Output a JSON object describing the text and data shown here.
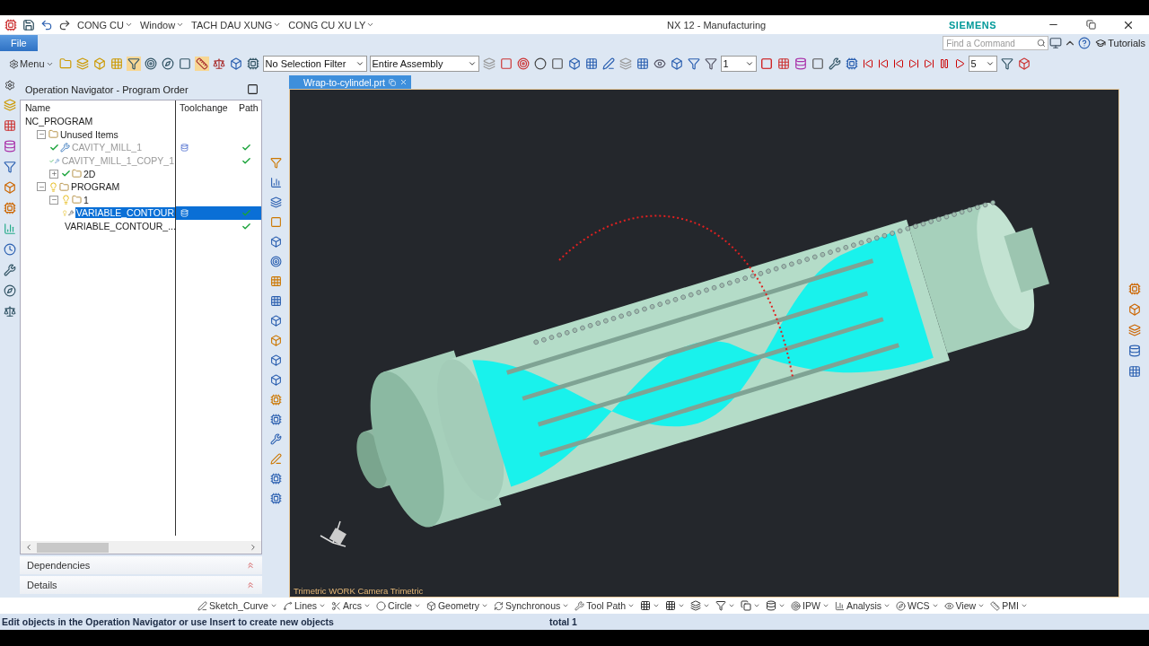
{
  "quick_access": {
    "menus": [
      {
        "label": "CONG CU"
      },
      {
        "label": "Window"
      },
      {
        "label": "TACH DAU XUNG"
      },
      {
        "label": "CONG CU XU LY"
      }
    ]
  },
  "window": {
    "title": "NX 12 - Manufacturing",
    "brand": "SIEMENS"
  },
  "ribbon_tabs": [
    {
      "label": "File",
      "selected": true
    }
  ],
  "command_search": {
    "placeholder": "Find a Command"
  },
  "help": {
    "label": "Tutorials"
  },
  "toolbar": {
    "menu": "Menu",
    "selection_filter": "No Selection Filter",
    "assembly_scope": "Entire Assembly",
    "layer": "1",
    "step": "5"
  },
  "navigator": {
    "title": "Operation Navigator - Program Order",
    "columns": [
      "Name",
      "Toolchange",
      "Path"
    ],
    "tree": [
      {
        "label": "NC_PROGRAM",
        "kind": "root",
        "children": [
          {
            "label": "Unused Items",
            "kind": "group",
            "expanded": true,
            "children": [
              {
                "label": "CAVITY_MILL_1",
                "kind": "operation",
                "complete": true,
                "disabled": true,
                "toolchange": true,
                "path_ok": true,
                "selected": false
              },
              {
                "label": "CAVITY_MILL_1_COPY_1",
                "kind": "operation",
                "complete": true,
                "disabled": true,
                "toolchange": false,
                "path_ok": true,
                "selected": false
              },
              {
                "label": "2D",
                "kind": "group",
                "expanded": false,
                "complete": true
              }
            ]
          },
          {
            "label": "PROGRAM",
            "kind": "group",
            "expanded": true,
            "complete": false,
            "children": [
              {
                "label": "1",
                "kind": "group",
                "expanded": true,
                "complete": false,
                "children": [
                  {
                    "label": "VARIABLE_CONTOUR",
                    "kind": "operation",
                    "complete": false,
                    "disabled": false,
                    "toolchange": true,
                    "path_ok": true,
                    "selected": true
                  },
                  {
                    "label": "VARIABLE_CONTOUR_...",
                    "kind": "operation",
                    "complete": false,
                    "disabled": false,
                    "toolchange": false,
                    "path_ok": true,
                    "selected": false
                  }
                ]
              }
            ]
          }
        ]
      }
    ],
    "panels": [
      {
        "label": "Dependencies",
        "expanded": false
      },
      {
        "label": "Details",
        "expanded": false
      }
    ]
  },
  "viewport": {
    "tab": "Wrap-to-cylindel.prt",
    "camera_label": "Trimetric WORK Camera Trimetric"
  },
  "bottom_toolbar": [
    {
      "kind": "menu",
      "label": "Sketch_Curve"
    },
    {
      "kind": "menu",
      "label": "Lines"
    },
    {
      "kind": "menu",
      "label": "Arcs"
    },
    {
      "kind": "menu",
      "label": "Circle"
    },
    {
      "kind": "menu",
      "label": "Geometry"
    },
    {
      "kind": "menu",
      "label": "Synchronous"
    },
    {
      "kind": "menu",
      "label": "Tool Path"
    },
    {
      "kind": "icon"
    },
    {
      "kind": "icon"
    },
    {
      "kind": "icon"
    },
    {
      "kind": "icon"
    },
    {
      "kind": "icon"
    },
    {
      "kind": "icon"
    },
    {
      "kind": "menu",
      "label": "IPW"
    },
    {
      "kind": "menu",
      "label": "Analysis"
    },
    {
      "kind": "menu",
      "label": "WCS"
    },
    {
      "kind": "menu",
      "label": "View"
    },
    {
      "kind": "menu",
      "label": "PMI"
    }
  ],
  "status_bar": {
    "message": "Edit objects in the Operation Navigator or use Insert to create new objects",
    "count": "total 1"
  }
}
